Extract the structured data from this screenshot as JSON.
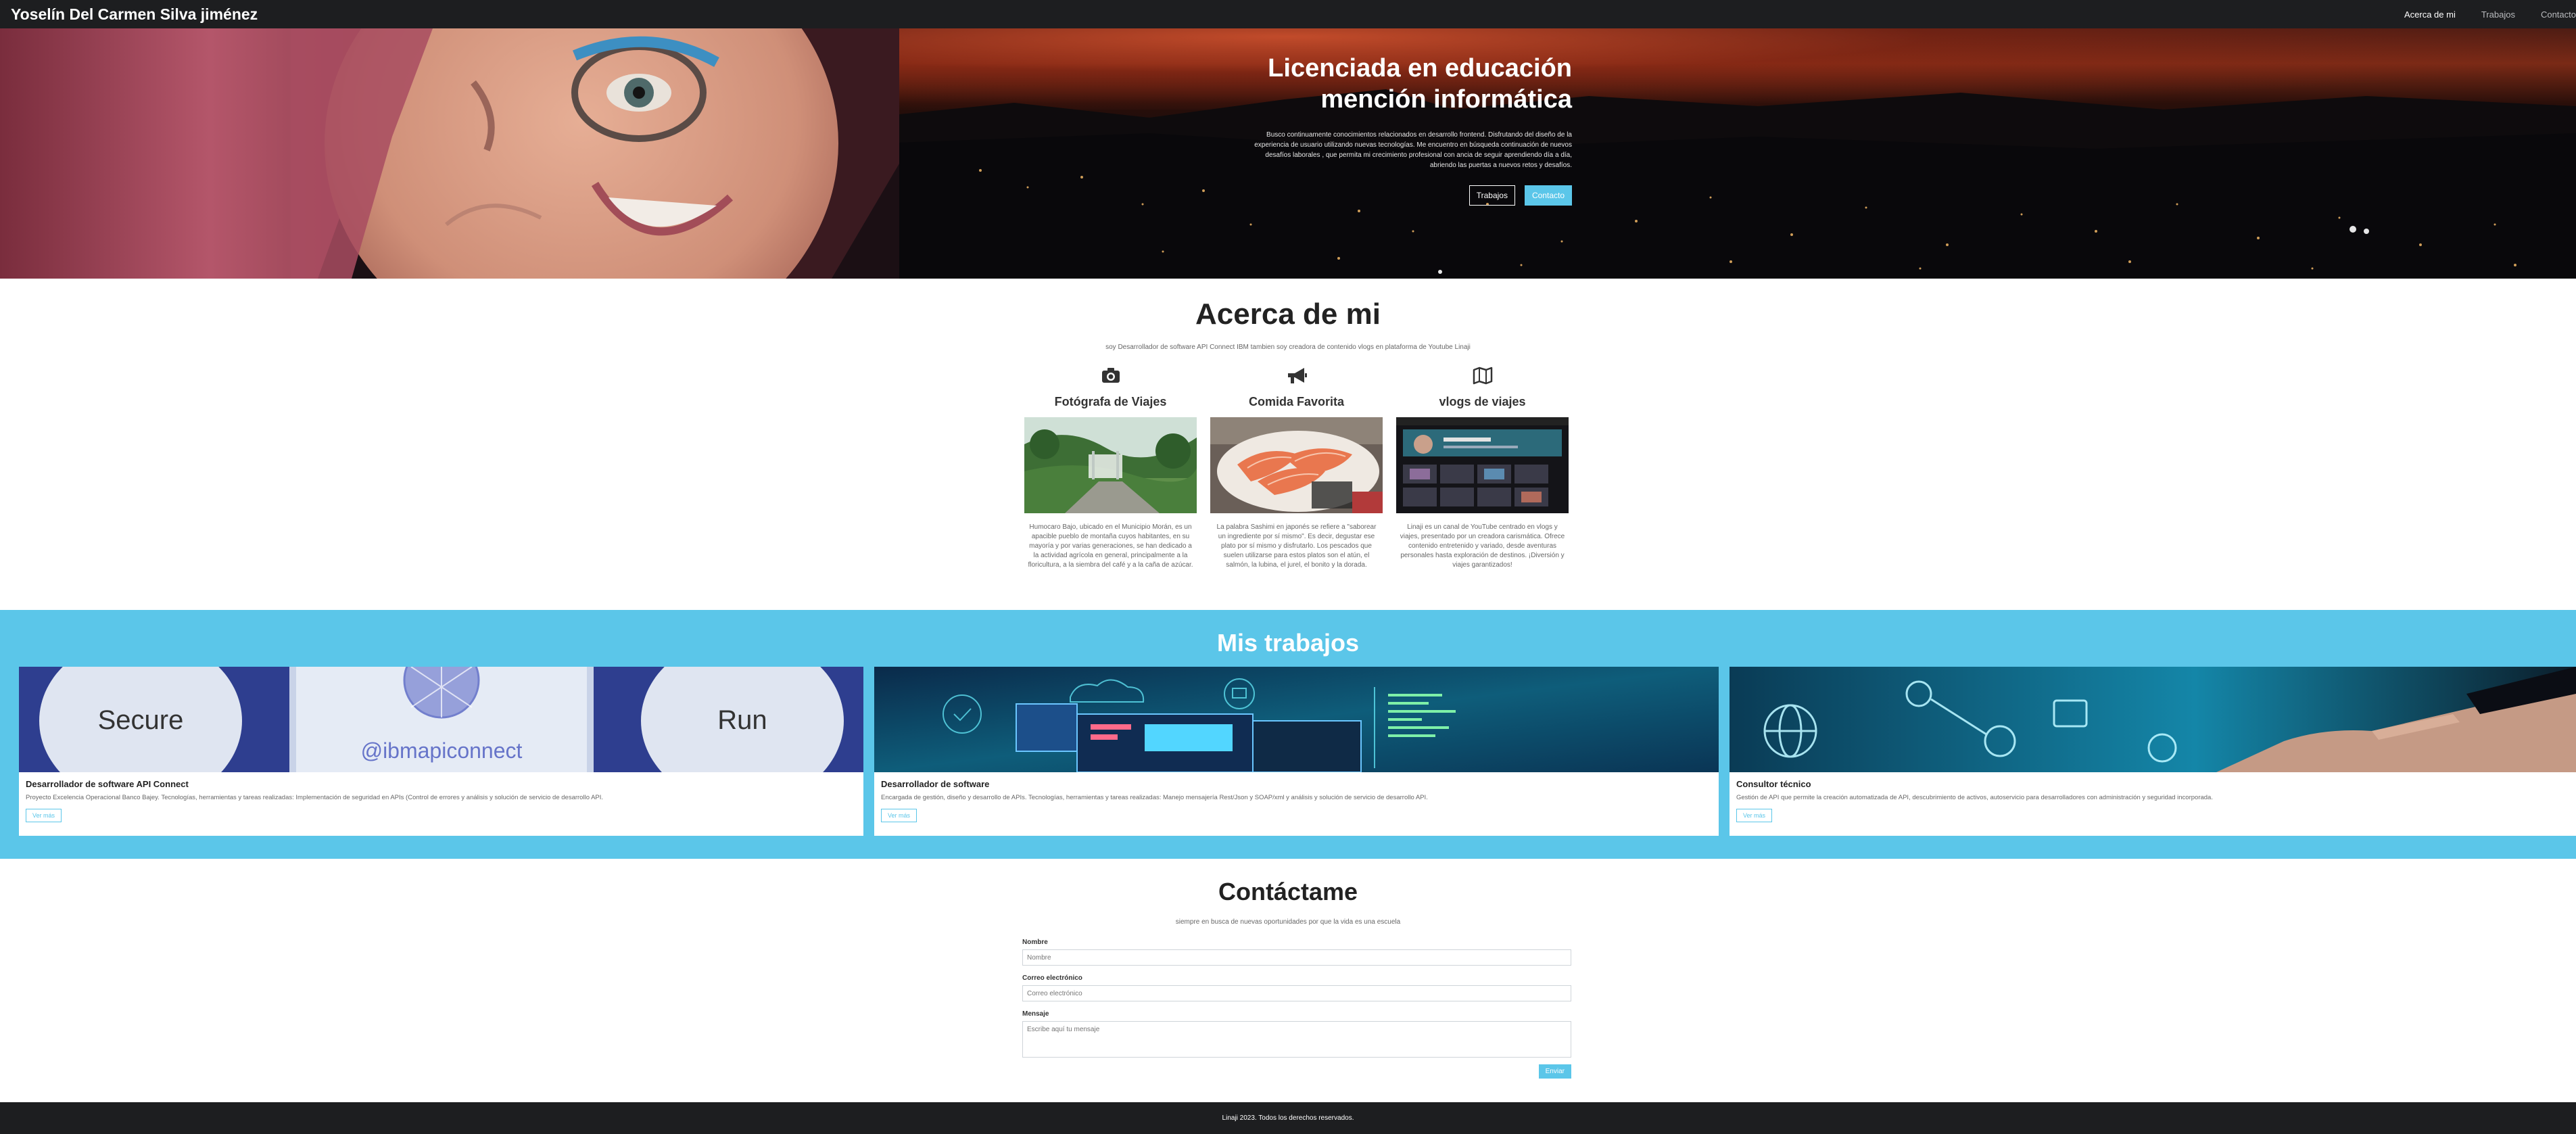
{
  "navbar": {
    "brand": "Yoselín Del Carmen Silva jiménez",
    "links": [
      "Acerca de mi",
      "Trabajos",
      "Contacto"
    ]
  },
  "hero": {
    "title_line1": "Licenciada en educación",
    "title_line2": "mención informática",
    "description": "Busco continuamente conocimientos relacionados en desarrollo frontend. Disfrutando del diseño de la experiencia de usuario utilizando nuevas tecnologías. Me encuentro en búsqueda continuación de nuevos desafíos laborales , que permita mi crecimiento profesional con ancia de seguir aprendiendo día a día, abriendo las puertas a nuevos retos y desafíos.",
    "btn_works": "Trabajos",
    "btn_contact": "Contacto"
  },
  "about": {
    "title": "Acerca de mi",
    "subtitle": "soy Desarrollador de software API Connect IBM tambien soy creadora de contenido vlogs en plataforma de Youtube Linaji",
    "columns": [
      {
        "icon": "camera-icon",
        "title": "Fotógrafa de Viajes",
        "text": "Humocaro Bajo, ubicado en el Municipio Morán, es un apacible pueblo de montaña cuyos habitantes, en su mayoría y por varias generaciones, se han dedicado a la actividad agrícola en general, principalmente a la floricultura, a la siembra del café y a la caña de azúcar."
      },
      {
        "icon": "megaphone-icon",
        "title": "Comida Favorita",
        "text": "La palabra Sashimi en japonés se refiere a \"saborear un ingrediente por sí mismo\". Es decir, degustar ese plato por sí mismo y disfrutarlo. Los pescados que suelen utilizarse para estos platos son el atún, el salmón, la lubina, el jurel, el bonito y la dorada."
      },
      {
        "icon": "map-icon",
        "title": "vlogs de viajes",
        "text": "Linaji es un canal de YouTube centrado en vlogs y viajes, presentado por un creadora carismática. Ofrece contenido entretenido y variado, desde aventuras personales hasta exploración de destinos. ¡Diversión y viajes garantizados!"
      }
    ]
  },
  "works": {
    "title": "Mis trabajos",
    "cards": [
      {
        "title": "Desarrollador de software API Connect",
        "text": "Proyecto Excelencia Operacional Banco Bajey. Tecnologías, herramientas y tareas realizadas: Implementación de seguridad en APIs (Control de errores y análisis y solución de servicio de desarrollo API.",
        "button": "Ver más",
        "image_words": [
          "Secure",
          "@ibmapiconnect",
          "Run"
        ]
      },
      {
        "title": "Desarrollador de software",
        "text": "Encargada de gestión, diseño y desarrollo de APIs. Tecnologías, herramientas y tareas realizadas: Manejo mensajería Rest/Json y SOAP/xml y análisis y solución de servicio de desarrollo API.",
        "button": "Ver más"
      },
      {
        "title": "Consultor técnico",
        "text": "Gestión de API que permite la creación automatizada de API, descubrimiento de activos, autoservicio para desarrolladores con administración y seguridad incorporada.",
        "button": "Ver más"
      }
    ]
  },
  "contact": {
    "title": "Contáctame",
    "subtitle": "siempre en busca de nuevas oportunidades por que la vida es una escuela",
    "name_label": "Nombre",
    "name_placeholder": "Nombre",
    "email_label": "Correo electrónico",
    "email_placeholder": "Correo electrónico",
    "message_label": "Mensaje",
    "message_placeholder": "Escribe aquí tu mensaje",
    "send": "Enviar"
  },
  "footer": {
    "text": "Linaji 2023. Todos los derechos reservados."
  },
  "colors": {
    "accent": "#5bc6e9",
    "dark": "#1d1e20"
  }
}
